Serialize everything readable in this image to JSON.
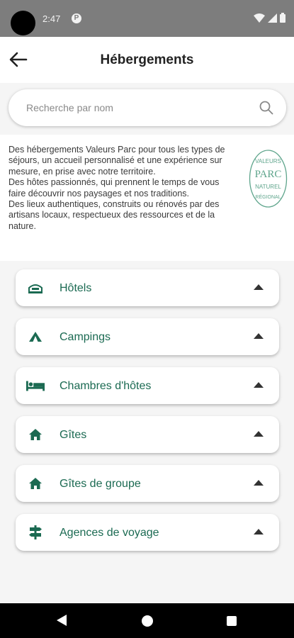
{
  "status_bar": {
    "time": "2:47",
    "notif_glyph": "P"
  },
  "header": {
    "title": "Hébergements",
    "back_icon": "arrow-left-icon"
  },
  "search": {
    "placeholder": "Recherche par nom",
    "value": "",
    "icon": "search-icon"
  },
  "intro": {
    "paragraphs": [
      "Des hébergements Valeurs Parc pour tous les types de séjours, un accueil personnalisé et une expérience sur mesure, en prise avec notre territoire.",
      "Des hôtes passionnés, qui prennent le temps de vous faire découvrir nos paysages et nos traditions.",
      "Des lieux authentiques, construits ou rénovés par des artisans locaux, respectueux des ressources et de la nature."
    ],
    "logo": {
      "top_text": "VALEURS",
      "main_text": "PARC",
      "sub_text": "NATUREL",
      "bottom_text": "RÉGIONAL"
    }
  },
  "categories": [
    {
      "label": "Hôtels",
      "icon": "hotel-icon"
    },
    {
      "label": "Campings",
      "icon": "tent-icon"
    },
    {
      "label": "Chambres d'hôtes",
      "icon": "bed-icon"
    },
    {
      "label": "Gîtes",
      "icon": "house-icon"
    },
    {
      "label": "Gîtes de groupe",
      "icon": "house-icon"
    },
    {
      "label": "Agences de voyage",
      "icon": "signpost-icon"
    }
  ],
  "colors": {
    "accent": "#1b6a52",
    "status_bar": "#7d7d7d",
    "background": "#f5f5f5"
  }
}
